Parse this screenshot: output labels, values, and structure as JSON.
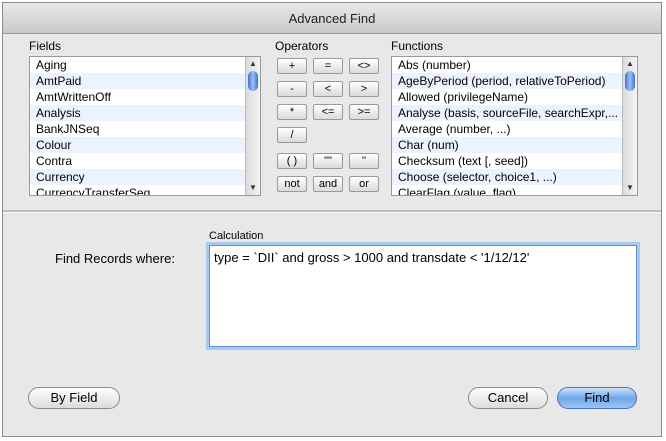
{
  "window": {
    "title": "Advanced Find"
  },
  "fields": {
    "label": "Fields",
    "items": [
      "Aging",
      "AmtPaid",
      "AmtWrittenOff",
      "Analysis",
      "BankJNSeq",
      "Colour",
      "Contra",
      "Currency",
      "CurrencyTransferSeq"
    ]
  },
  "operators": {
    "label": "Operators",
    "rows": [
      [
        "+",
        "=",
        "<>"
      ],
      [
        "-",
        "<",
        ">"
      ],
      [
        "*",
        "<=",
        ">="
      ],
      [
        "/"
      ],
      [
        "( )",
        "\"\"",
        "''"
      ],
      [
        "not",
        "and",
        "or"
      ]
    ]
  },
  "functions": {
    "label": "Functions",
    "items": [
      "Abs (number)",
      "AgeByPeriod (period, relativeToPeriod)",
      "Allowed (privilegeName)",
      "Analyse (basis, sourceFile, searchExpr,...",
      "Average (number, ...)",
      "Char (num)",
      "Checksum (text [, seed])",
      "Choose (selector, choice1, ...)",
      "ClearFlag (value, flag)"
    ]
  },
  "find": {
    "label": "Find Records where:",
    "calc_label": "Calculation",
    "value": "type = `DII` and gross > 1000 and transdate < '1/12/12'"
  },
  "buttons": {
    "by_field": "By Field",
    "cancel": "Cancel",
    "find": "Find"
  },
  "colors": {
    "accent": "#5a8fd8",
    "default_button": "#6ea6e8"
  }
}
